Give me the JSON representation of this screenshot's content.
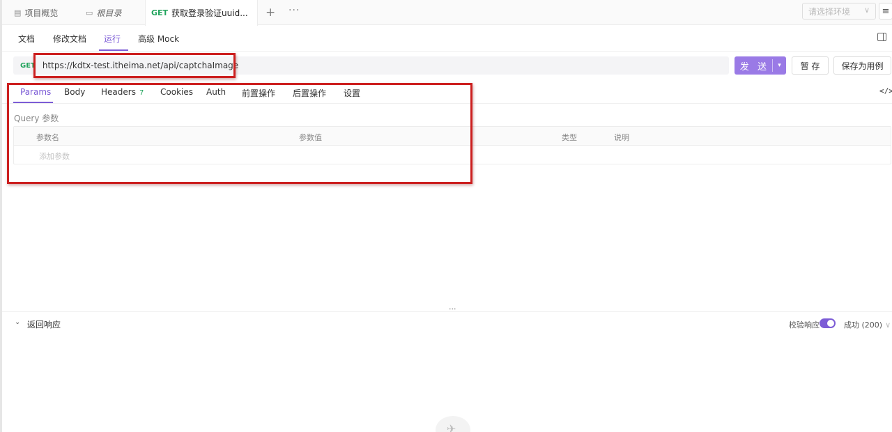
{
  "tabbar": {
    "overview": "项目概览",
    "root": "根目录",
    "active_method": "GET",
    "active_title": "获取登录验证uuid...",
    "add": "+",
    "more": "···",
    "env_placeholder": "请选择环境"
  },
  "subnav": {
    "items": [
      "文档",
      "修改文档",
      "运行",
      "高级 Mock"
    ],
    "active_index": 2
  },
  "request": {
    "method": "GET",
    "url": "https://kdtx-test.itheima.net/api/captchaImage",
    "send_label": "发 送",
    "save_temp_label": "暂 存",
    "save_case_label": "保存为用例"
  },
  "param_tabs": {
    "items": [
      "Params",
      "Body",
      "Headers",
      "Cookies",
      "Auth",
      "前置操作",
      "后置操作",
      "设置"
    ],
    "headers_count": "7",
    "active_index": 0
  },
  "query": {
    "label": "Query 参数",
    "columns": [
      "参数名",
      "参数值",
      "类型",
      "说明"
    ],
    "add_placeholder": "添加参数"
  },
  "response": {
    "title": "返回响应",
    "verify_label": "校验响应",
    "verify_on": true,
    "status_select": "成功 (200)"
  },
  "colors": {
    "accent": "#7c5cd6",
    "send_bg": "#9a7ae6",
    "get_method": "#22a45d",
    "annotation": "#cc1f1f"
  }
}
